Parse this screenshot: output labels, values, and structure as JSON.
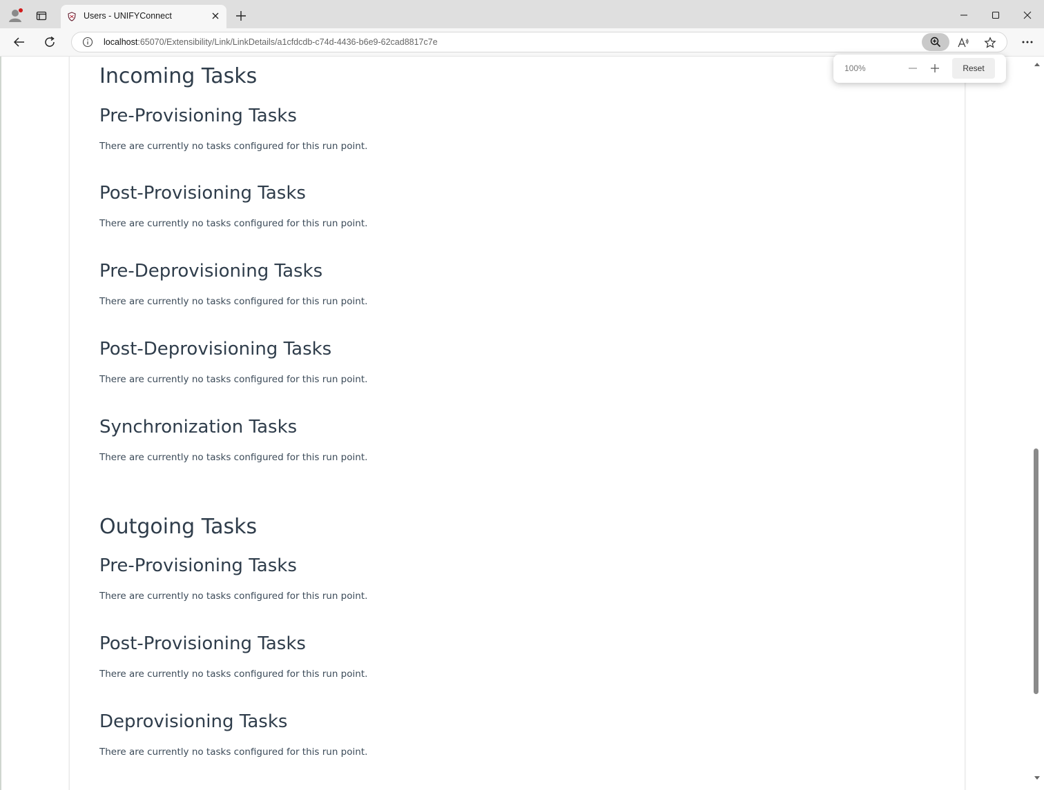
{
  "browser": {
    "tab_title": "Users - UNIFYConnect",
    "url_host": "localhost",
    "url_rest": ":65070/Extensibility/Link/LinkDetails/a1cfdcdb-c74d-4436-b6e9-62cad8817c7e"
  },
  "zoom_popup": {
    "level": "100%",
    "reset_label": "Reset"
  },
  "page": {
    "incoming": {
      "title": "Incoming Tasks",
      "sections": [
        {
          "title": "Pre-Provisioning Tasks",
          "text": "There are currently no tasks configured for this run point."
        },
        {
          "title": "Post-Provisioning Tasks",
          "text": "There are currently no tasks configured for this run point."
        },
        {
          "title": "Pre-Deprovisioning Tasks",
          "text": "There are currently no tasks configured for this run point."
        },
        {
          "title": "Post-Deprovisioning Tasks",
          "text": "There are currently no tasks configured for this run point."
        },
        {
          "title": "Synchronization Tasks",
          "text": "There are currently no tasks configured for this run point."
        }
      ]
    },
    "outgoing": {
      "title": "Outgoing Tasks",
      "sections": [
        {
          "title": "Pre-Provisioning Tasks",
          "text": "There are currently no tasks configured for this run point."
        },
        {
          "title": "Post-Provisioning Tasks",
          "text": "There are currently no tasks configured for this run point."
        },
        {
          "title": "Deprovisioning Tasks",
          "text": "There are currently no tasks configured for this run point."
        }
      ]
    }
  },
  "icons": {
    "profile": "profile-icon",
    "tab_actions": "tab-actions-icon",
    "favicon": "shield-favicon-icon",
    "close_tab": "close-icon",
    "new_tab": "plus-icon",
    "back": "back-arrow-icon",
    "refresh": "refresh-icon",
    "info": "info-icon",
    "zoom": "zoom-in-icon",
    "read_aloud": "read-aloud-icon",
    "favorite": "star-icon",
    "more": "more-icon"
  }
}
